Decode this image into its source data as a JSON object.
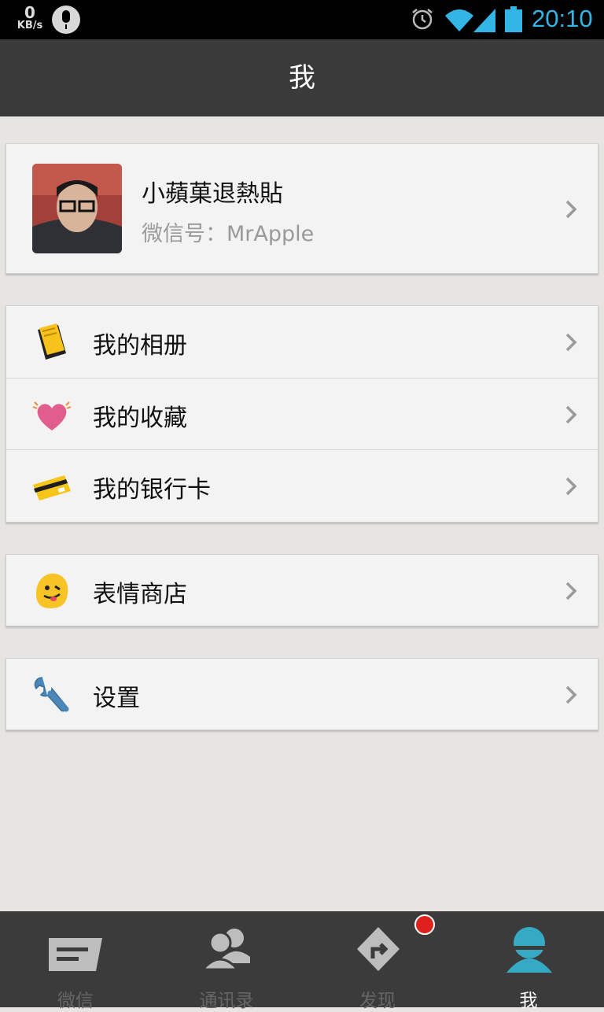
{
  "status_bar": {
    "net_speed_value": "0",
    "net_speed_unit": "KB/s",
    "time": "20:10"
  },
  "header": {
    "title": "我"
  },
  "profile": {
    "name": "小蘋菓退熱貼",
    "wechat_id": "微信号：MrApple"
  },
  "menu": {
    "group1": [
      {
        "label": "我的相册",
        "icon": "photo-album-icon"
      },
      {
        "label": "我的收藏",
        "icon": "favorites-heart-icon"
      },
      {
        "label": "我的银行卡",
        "icon": "bank-card-icon"
      }
    ],
    "group2": [
      {
        "label": "表情商店",
        "icon": "emoji-store-icon"
      }
    ],
    "group3": [
      {
        "label": "设置",
        "icon": "wrench-settings-icon"
      }
    ]
  },
  "tabs": [
    {
      "label": "微信",
      "icon": "chat-icon",
      "active": false
    },
    {
      "label": "通讯录",
      "icon": "contacts-icon",
      "active": false
    },
    {
      "label": "发现",
      "icon": "discover-icon",
      "active": false,
      "has_badge": true
    },
    {
      "label": "我",
      "icon": "me-icon",
      "active": true
    }
  ],
  "colors": {
    "accent": "#33b5e5",
    "active_tab": "#36a9c5",
    "header_bg": "#3a3a3a",
    "badge": "#e0201c"
  }
}
